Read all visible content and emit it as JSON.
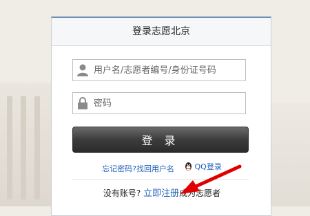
{
  "header": {
    "title": "登录志愿北京"
  },
  "username": {
    "placeholder": "用户名/志愿者编号/身份证号码"
  },
  "password": {
    "placeholder": "密码"
  },
  "login_button": {
    "label": "登 录"
  },
  "links": {
    "forgot": "忘记密码?",
    "recover": "找回用户名",
    "qq": "QQ登录"
  },
  "register": {
    "prefix": "没有账号?",
    "link": "立即注册",
    "suffix": "成为志愿者"
  },
  "colors": {
    "accent_link": "#1d5fb8",
    "arrow": "#e00000",
    "button_dark": "#3c3c3c"
  },
  "icons": {
    "user": "user-icon",
    "lock": "lock-icon",
    "qq": "qq-penguin-icon",
    "arrow": "red-arrow-annotation"
  }
}
